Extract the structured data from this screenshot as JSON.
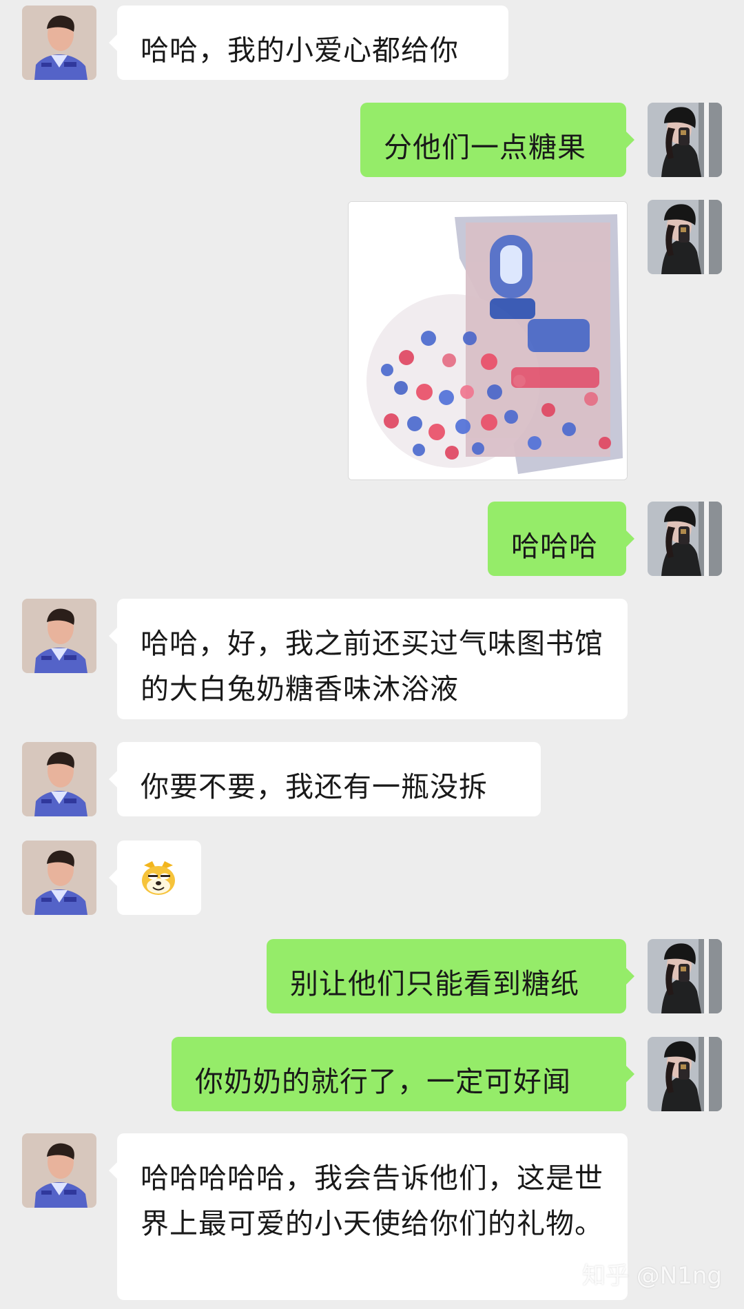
{
  "messages": [
    {
      "side": "in",
      "text": "哈哈，我的小爱心都给你"
    },
    {
      "side": "out",
      "text": "分他们一点糖果"
    },
    {
      "side": "out",
      "type": "image",
      "caption_icon": "candy-bag-image"
    },
    {
      "side": "out",
      "text": "哈哈哈"
    },
    {
      "side": "in",
      "text": "哈哈，好，我之前还买过气味图书馆的大白兔奶糖香味沐浴液"
    },
    {
      "side": "in",
      "text": "你要不要，我还有一瓶没拆"
    },
    {
      "side": "in",
      "type": "emoji",
      "emoji_name": "doge-emoji"
    },
    {
      "side": "out",
      "text": "别让他们只能看到糖纸"
    },
    {
      "side": "out",
      "text": "你奶奶的就行了，一定可好闻"
    },
    {
      "side": "in",
      "text": "哈哈哈哈哈，我会告诉他们，这是世界上最可爱的小天使给你们的礼物。"
    }
  ],
  "watermark": "知乎 @N1ng",
  "colors": {
    "background": "#ededed",
    "incoming_bubble": "#ffffff",
    "outgoing_bubble": "#95ec69"
  }
}
